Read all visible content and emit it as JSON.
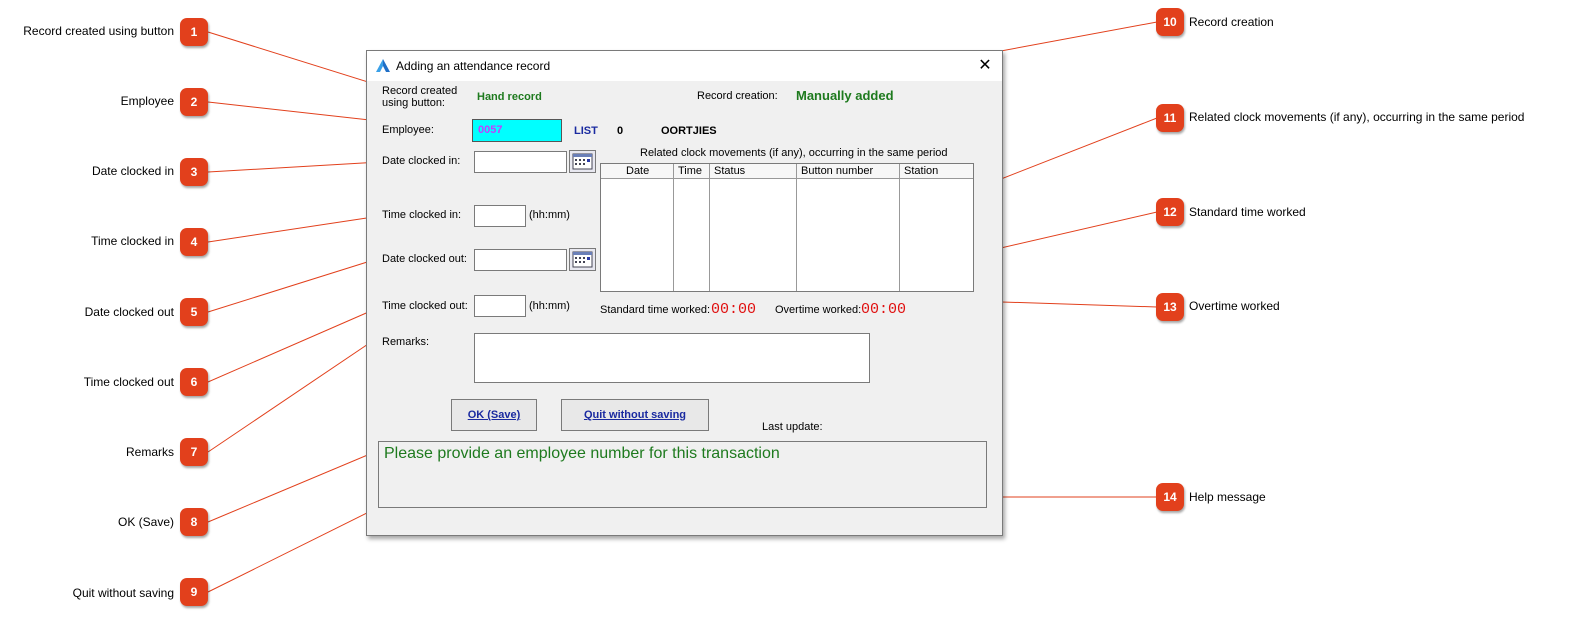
{
  "dialog": {
    "title": "Adding an attendance record",
    "close_symbol": "✕",
    "record_created_label_line1": "Record created",
    "record_created_label_line2": "using button:",
    "record_created_value": "Hand record",
    "record_creation_label": "Record creation:",
    "record_creation_value": "Manually added",
    "employee_label": "Employee:",
    "employee_value": "0057",
    "list_link": "LIST",
    "employee_code": "0",
    "employee_name": "OORTJIES",
    "date_in_label": "Date clocked in:",
    "time_in_label": "Time clocked in:",
    "time_in_hint": "(hh:mm)",
    "date_out_label": "Date clocked out:",
    "time_out_label": "Time clocked out:",
    "time_out_hint": "(hh:mm)",
    "remarks_label": "Remarks:",
    "related_title": "Related clock movements (if any), occurring in the same period",
    "columns": [
      "Date",
      "Time",
      "Status",
      "Button number",
      "Station"
    ],
    "standard_label": "Standard time worked:",
    "standard_value": "00:00",
    "overtime_label": "Overtime worked:",
    "overtime_value": "00:00",
    "ok_button": "OK (Save)",
    "quit_button": "Quit without saving",
    "last_update_label": "Last update:",
    "help_message": "Please provide an employee number for this transaction"
  },
  "callouts": [
    {
      "num": "1",
      "label": "Record created using button"
    },
    {
      "num": "2",
      "label": "Employee"
    },
    {
      "num": "3",
      "label": "Date clocked in"
    },
    {
      "num": "4",
      "label": "Time clocked in"
    },
    {
      "num": "5",
      "label": "Date clocked out"
    },
    {
      "num": "6",
      "label": "Time clocked out"
    },
    {
      "num": "7",
      "label": "Remarks"
    },
    {
      "num": "8",
      "label": "OK (Save)"
    },
    {
      "num": "9",
      "label": "Quit without saving"
    },
    {
      "num": "10",
      "label": "Record creation"
    },
    {
      "num": "11",
      "label": "Related clock movements (if any), occurring in the same period"
    },
    {
      "num": "12",
      "label": "Standard time worked"
    },
    {
      "num": "13",
      "label": "Overtime worked"
    },
    {
      "num": "14",
      "label": "Help message"
    }
  ],
  "colors": {
    "badge": "#e2401c",
    "line": "#e2401c",
    "green": "#1e7a1e",
    "red_time": "#e01010",
    "employee_bg": "#00ffff"
  },
  "icons": {
    "app": "app-logo-icon",
    "calendar": "calendar-icon",
    "close": "close-icon"
  }
}
